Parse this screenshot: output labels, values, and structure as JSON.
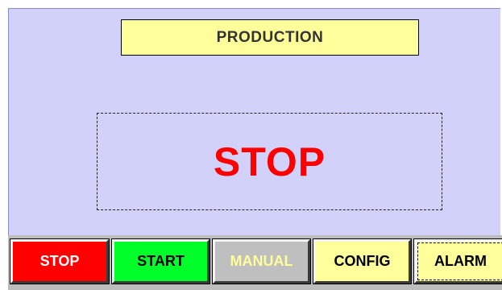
{
  "screen": {
    "title": "PRODUCTION",
    "status": "STOP"
  },
  "buttons": {
    "stop": "STOP",
    "start": "START",
    "manual": "MANUAL",
    "config": "CONFIG",
    "alarm": "ALARM"
  },
  "colors": {
    "panel_background": "#d1d1fa",
    "title_background": "#fefe9a",
    "status_text": "#ff0000",
    "stop_button": "#ff0000",
    "start_button": "#00ff2a",
    "manual_button": "#bfbfbf",
    "config_button": "#fefe9a",
    "alarm_button": "#fefe9a"
  },
  "state": {
    "manual_enabled": false,
    "alarm_selected": true
  }
}
